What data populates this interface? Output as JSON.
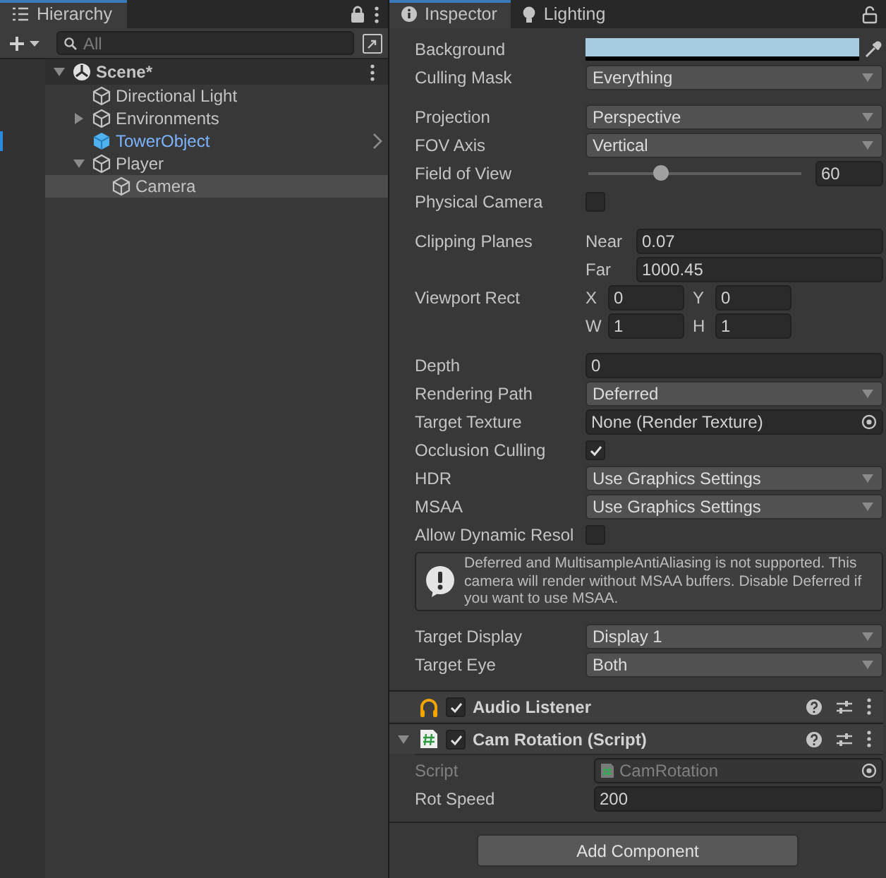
{
  "hierarchy": {
    "tab": {
      "title": "Hierarchy"
    },
    "search": {
      "placeholder": "All"
    },
    "scene": {
      "name": "Scene*",
      "expanded": true,
      "children": [
        {
          "name": "Directional Light",
          "kind": "object",
          "selected": false
        },
        {
          "name": "Environments",
          "kind": "object",
          "expanded": false,
          "selected": false
        },
        {
          "name": "TowerObject",
          "kind": "prefab",
          "selected": false
        },
        {
          "name": "Player",
          "kind": "object",
          "expanded": true,
          "selected": false,
          "children": [
            {
              "name": "Camera",
              "kind": "object",
              "selected": true
            }
          ]
        }
      ]
    }
  },
  "inspector": {
    "tabs": [
      {
        "label": "Inspector",
        "kind": "inspector",
        "selected": true
      },
      {
        "label": "Lighting",
        "kind": "lighting",
        "selected": false
      }
    ],
    "property_groups": [
      {
        "properties": [
          {
            "label": "Background",
            "kind": "color",
            "color": "#a7cbdf"
          },
          {
            "label": "Culling Mask",
            "kind": "dropdown",
            "value": "Everything"
          }
        ]
      },
      {
        "properties": [
          {
            "label": "Projection",
            "kind": "dropdown",
            "value": "Perspective"
          },
          {
            "label": "FOV Axis",
            "kind": "dropdown",
            "value": "Vertical"
          },
          {
            "label": "Field of View",
            "kind": "slider",
            "level": 0.33,
            "value": "60"
          },
          {
            "label": "Physical Camera",
            "kind": "checkbox",
            "checked": false
          }
        ]
      },
      {
        "properties": [
          {
            "label": "Clipping Planes",
            "kind": "pair",
            "fields": [
              {
                "label": "Near",
                "value": "0.07"
              },
              {
                "label": "Far",
                "value": "1000.45"
              }
            ]
          },
          {
            "label": "Viewport Rect",
            "kind": "grid",
            "fields": [
              {
                "label": "X",
                "value": "0"
              },
              {
                "label": "Y",
                "value": "0"
              },
              {
                "label": "W",
                "value": "1"
              },
              {
                "label": "H",
                "value": "1"
              }
            ]
          }
        ]
      },
      {
        "properties": [
          {
            "label": "Depth",
            "kind": "number",
            "value": "0"
          },
          {
            "label": "Rendering Path",
            "kind": "dropdown",
            "value": "Deferred"
          },
          {
            "label": "Target Texture",
            "kind": "object",
            "value": "None (Render Texture)"
          },
          {
            "label": "Occlusion Culling",
            "kind": "checkbox",
            "checked": true
          },
          {
            "label": "HDR",
            "kind": "dropdown",
            "value": "Use Graphics Settings"
          },
          {
            "label": "MSAA",
            "kind": "dropdown",
            "value": "Use Graphics Settings"
          },
          {
            "label": "Allow Dynamic Resol",
            "kind": "checkbox",
            "checked": false
          },
          {
            "kind": "help",
            "text": "Deferred and MultisampleAntiAliasing is not supported. This camera will render without MSAA buffers. Disable Deferred if you want to use MSAA."
          }
        ]
      },
      {
        "properties": [
          {
            "label": "Target Display",
            "kind": "dropdown",
            "value": "Display 1"
          },
          {
            "label": "Target Eye",
            "kind": "dropdown",
            "value": "Both"
          }
        ]
      }
    ],
    "components": [
      {
        "name": "Audio Listener",
        "kind": "audio",
        "enabled": true
      },
      {
        "name": "Cam Rotation (Script)",
        "kind": "script",
        "enabled": true,
        "expanded": true,
        "fields": [
          {
            "label": "Script",
            "kind": "script-ref",
            "value": "CamRotation",
            "disabled": true
          },
          {
            "label": "Rot Speed",
            "kind": "number",
            "value": "200",
            "disabled": false
          }
        ]
      }
    ],
    "add_button": "Add Component"
  }
}
